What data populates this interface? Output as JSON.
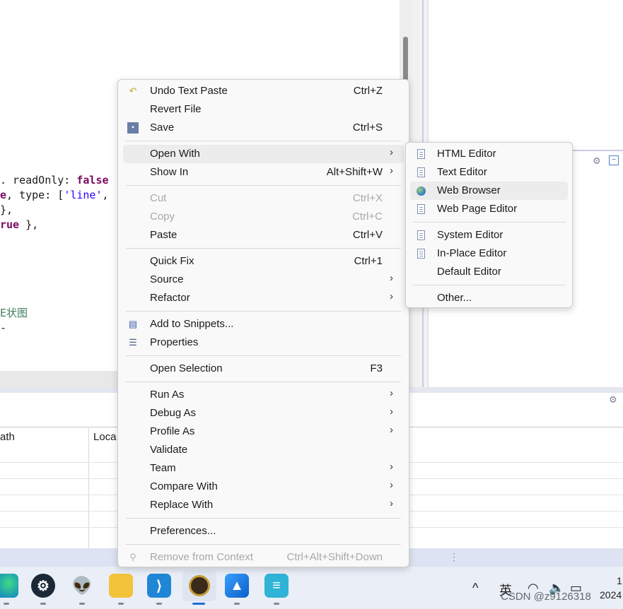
{
  "editor": {
    "code_lines": [
      {
        "pre": ". readOnly: ",
        "kw": "false",
        "post": ""
      },
      {
        "pre": "",
        "kw": "e",
        "post": ", type: [",
        "str": "'line'",
        "tail": ","
      },
      {
        "pre": "},",
        "kw": "",
        "post": ""
      },
      {
        "pre": "",
        "kw": "rue",
        "post": " },"
      }
    ],
    "comment_text": "E状图",
    "comment_tail": "-"
  },
  "bottom_panel": {
    "columns": [
      "ath",
      "Loca"
    ]
  },
  "context_menu": {
    "items": [
      {
        "label": "Undo Text Paste",
        "shortcut": "Ctrl+Z",
        "icon": "undo-icon"
      },
      {
        "label": "Revert File",
        "shortcut": ""
      },
      {
        "label": "Save",
        "shortcut": "Ctrl+S",
        "icon": "save-icon"
      },
      {
        "label": "Open With",
        "shortcut": ""
      },
      {
        "label": "Show In",
        "shortcut": "Alt+Shift+W"
      },
      {
        "label": "Cut",
        "shortcut": "Ctrl+X"
      },
      {
        "label": "Copy",
        "shortcut": "Ctrl+C"
      },
      {
        "label": "Paste",
        "shortcut": "Ctrl+V"
      },
      {
        "label": "Quick Fix",
        "shortcut": "Ctrl+1"
      },
      {
        "label": "Source",
        "shortcut": ""
      },
      {
        "label": "Refactor",
        "shortcut": ""
      },
      {
        "label": "Add to Snippets...",
        "shortcut": "",
        "icon": "snippets-icon"
      },
      {
        "label": "Properties",
        "shortcut": "",
        "icon": "properties-icon"
      },
      {
        "label": "Open Selection",
        "shortcut": "F3"
      },
      {
        "label": "Run As",
        "shortcut": ""
      },
      {
        "label": "Debug As",
        "shortcut": ""
      },
      {
        "label": "Profile As",
        "shortcut": ""
      },
      {
        "label": "Validate",
        "shortcut": ""
      },
      {
        "label": "Team",
        "shortcut": ""
      },
      {
        "label": "Compare With",
        "shortcut": ""
      },
      {
        "label": "Replace With",
        "shortcut": ""
      },
      {
        "label": "Preferences...",
        "shortcut": ""
      },
      {
        "label": "Remove from Context",
        "shortcut": "Ctrl+Alt+Shift+Down",
        "icon": "remove-context-icon"
      }
    ],
    "submenu_arrow": "›"
  },
  "open_with_submenu": {
    "items": [
      {
        "label": "HTML Editor",
        "icon": "document-icon"
      },
      {
        "label": "Text Editor",
        "icon": "document-icon"
      },
      {
        "label": "Web Browser",
        "icon": "globe-icon"
      },
      {
        "label": "Web Page Editor",
        "icon": "web-page-editor-icon"
      },
      {
        "label": "System Editor",
        "icon": "document-icon"
      },
      {
        "label": "In-Place Editor",
        "icon": "document-icon"
      },
      {
        "label": "Default Editor",
        "icon": ""
      },
      {
        "label": "Other...",
        "icon": ""
      }
    ]
  },
  "taskbar": {
    "apps": [
      "edge-icon",
      "steam-icon",
      "alienware-icon",
      "file-explorer-icon",
      "vscode-icon",
      "eclipse-icon",
      "photos-icon",
      "notepad-icon"
    ],
    "ime_label": "英",
    "clock_top": "1",
    "clock_bottom": "2024"
  },
  "watermark": "CSDN @z9126318"
}
